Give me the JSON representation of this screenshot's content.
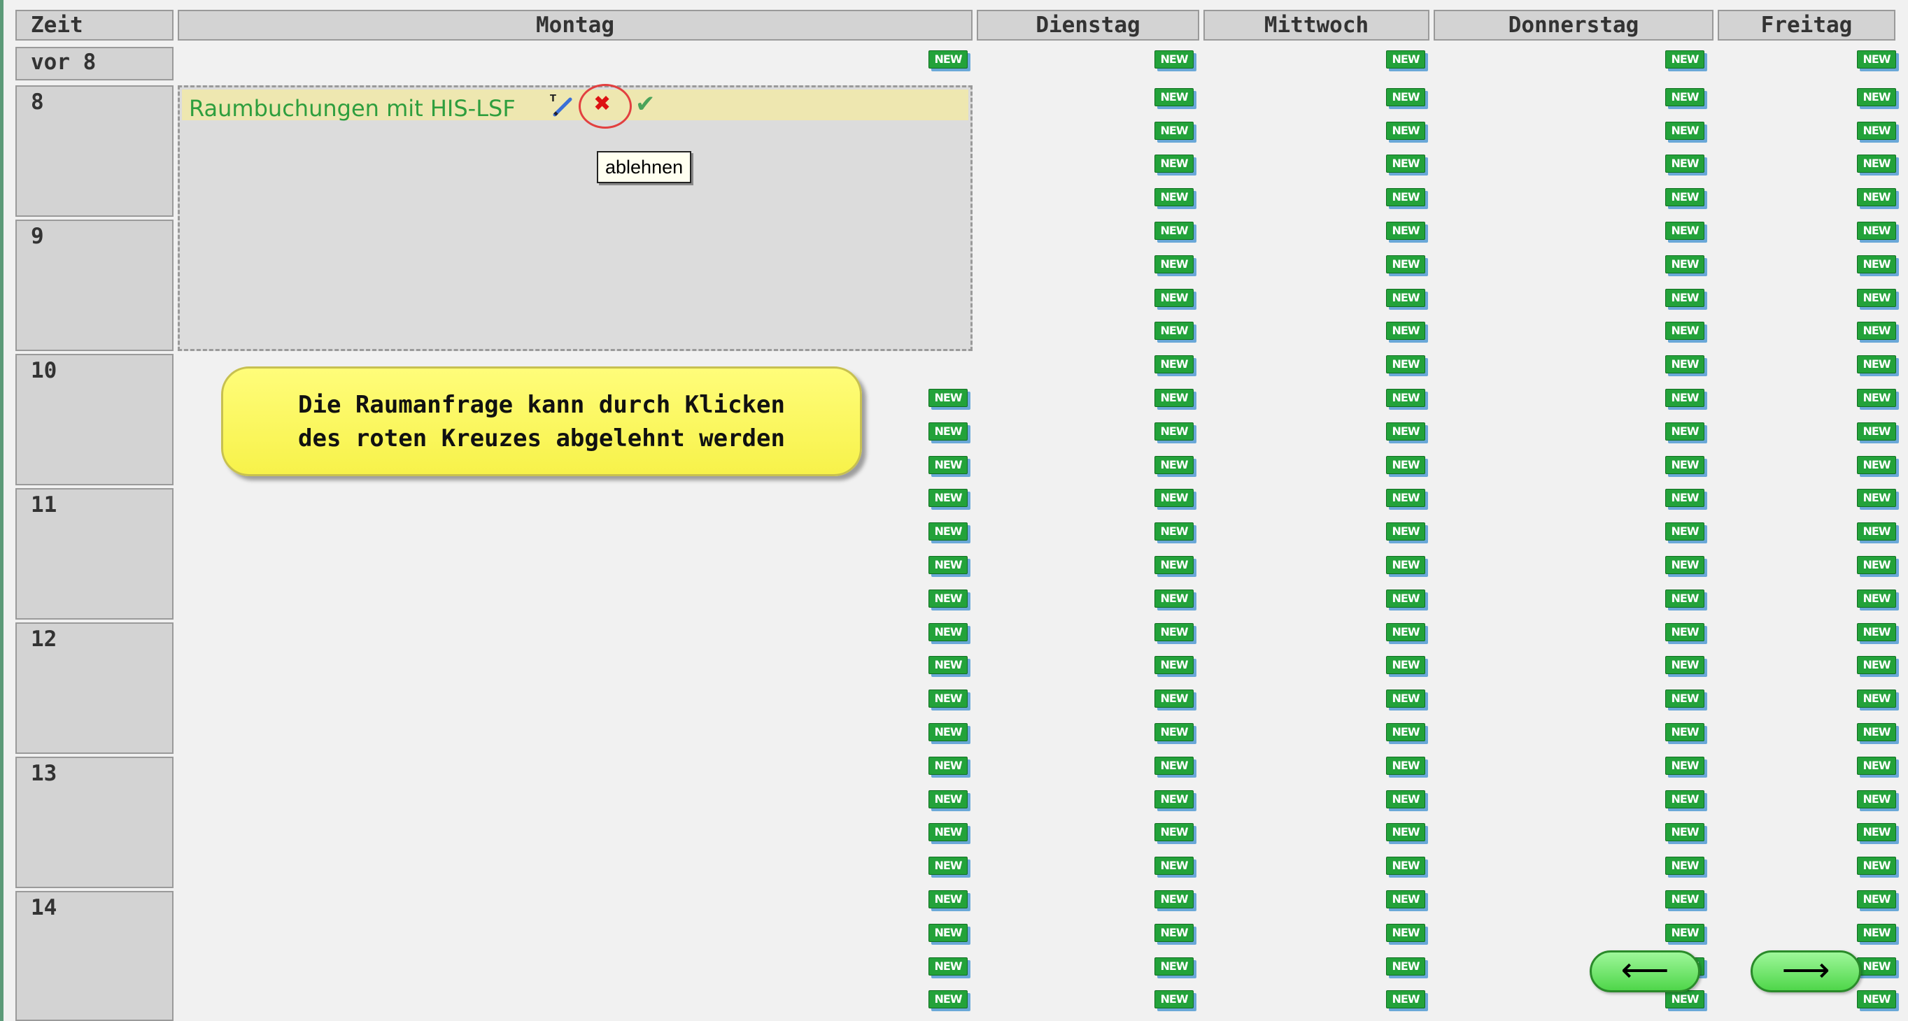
{
  "header": {
    "time_label": "Zeit",
    "days": [
      "Montag",
      "Dienstag",
      "Mittwoch",
      "Donnerstag",
      "Freitag"
    ]
  },
  "time_slots": [
    "vor 8",
    "8",
    "9",
    "10",
    "11",
    "12",
    "13",
    "14"
  ],
  "new_button_label": "NEW",
  "event": {
    "title": "Raumbuchungen mit HIS-LSF",
    "edit_icon": "edit-pencil-icon",
    "reject_icon": "red-cross-icon",
    "accept_icon": "green-checkmark-icon"
  },
  "tooltip": {
    "text": "ablehnen"
  },
  "callout": {
    "line1": "Die Raumanfrage kann durch Klicken",
    "line2": "des roten Kreuzes abgelehnt werden"
  },
  "navigation": {
    "prev_icon": "arrow-left-icon",
    "next_icon": "arrow-right-icon",
    "prev_symbol": "⟵",
    "next_symbol": "⟶"
  },
  "colors": {
    "event_title": "#2e9e3e",
    "new_badge": "#23a23a",
    "callout": "#fffd7a",
    "reject": "#d11111"
  }
}
